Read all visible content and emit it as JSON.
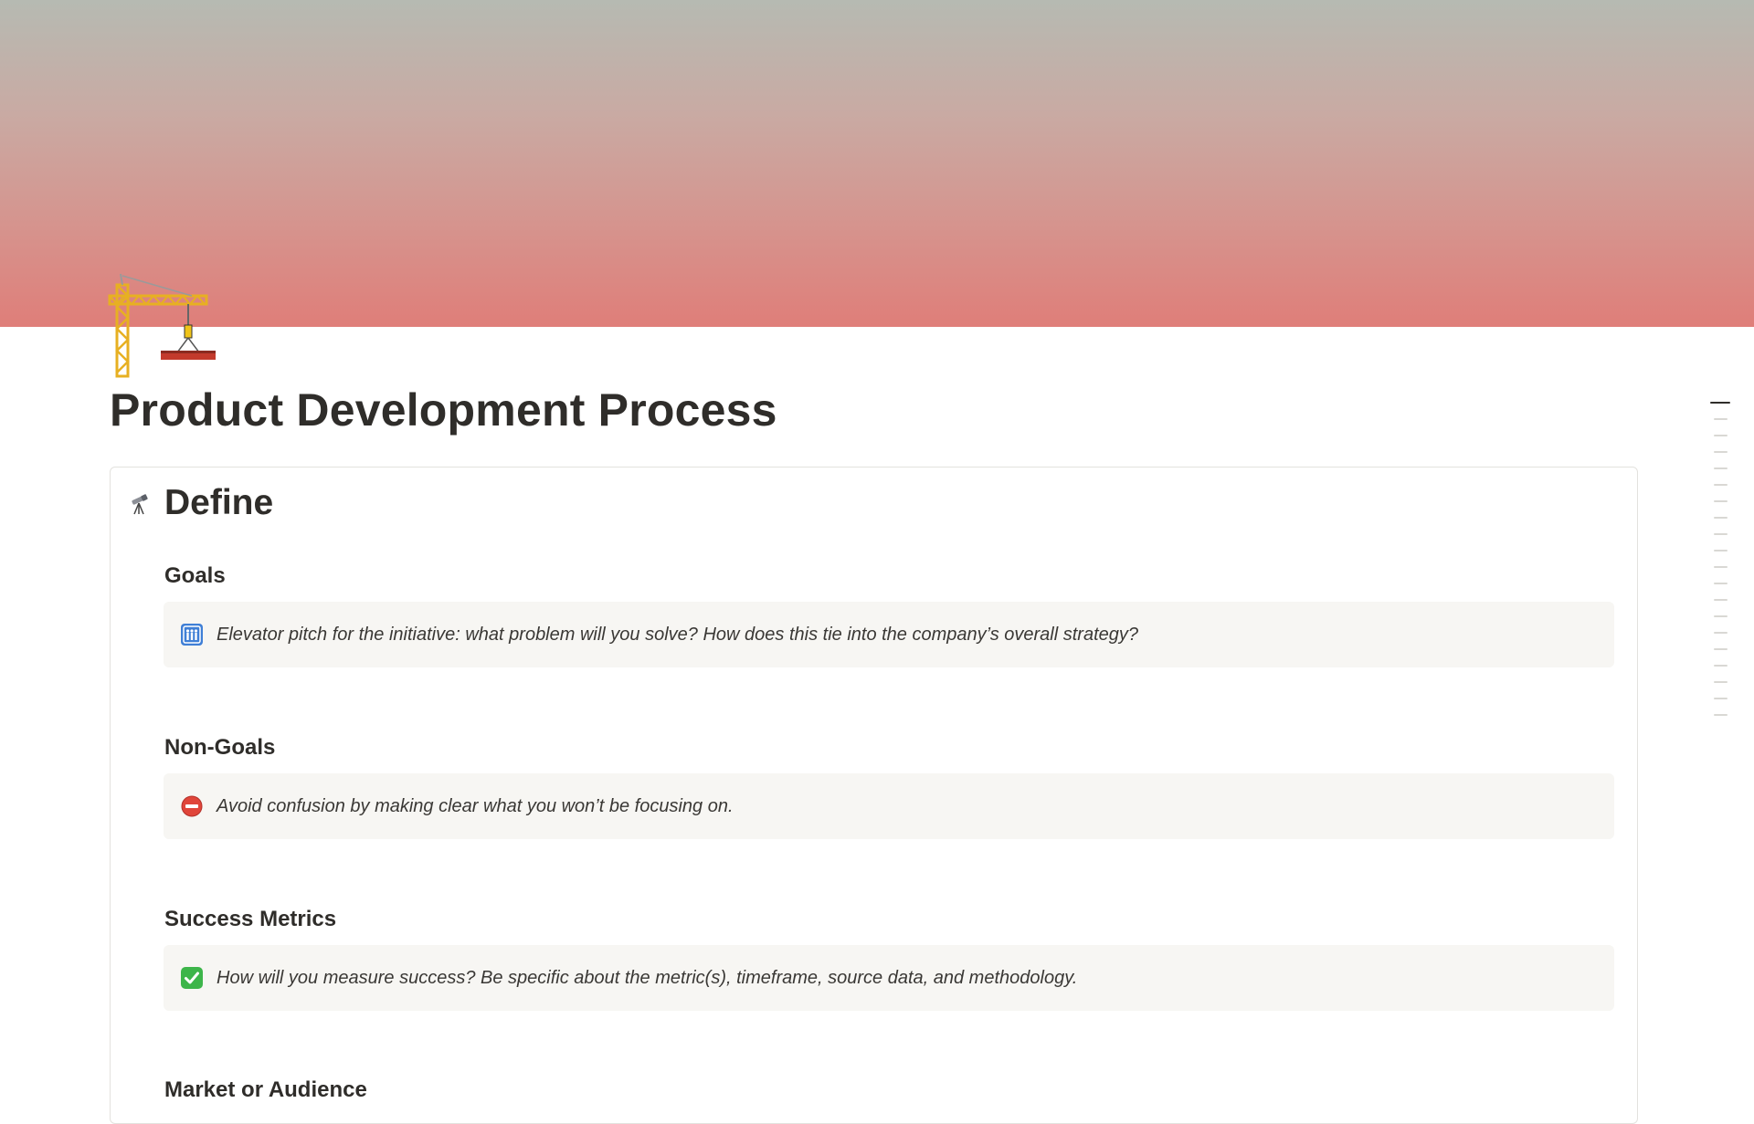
{
  "cover": {
    "colors": {
      "top": "#b6bab2",
      "bottom": "#df7e79"
    }
  },
  "page": {
    "icon": "construction-crane-icon",
    "title": "Product Development Process"
  },
  "sections": [
    {
      "icon": "telescope-icon",
      "title": "Define",
      "subsections": [
        {
          "heading": "Goals",
          "callout_icon": "people-sign-icon",
          "callout_text": "Elevator pitch for the initiative: what problem will you solve? How does this tie into the company’s overall strategy?"
        },
        {
          "heading": "Non-Goals",
          "callout_icon": "no-entry-icon",
          "callout_text": "Avoid confusion by making clear what you won’t be focusing on."
        },
        {
          "heading": "Success Metrics",
          "callout_icon": "check-mark-button-icon",
          "callout_text": "How will you measure success? Be specific about the metric(s), timeframe, source data, and methodology."
        },
        {
          "heading": "Market or Audience"
        }
      ]
    }
  ],
  "outline": {
    "item_count": 20,
    "active_index": 0
  }
}
